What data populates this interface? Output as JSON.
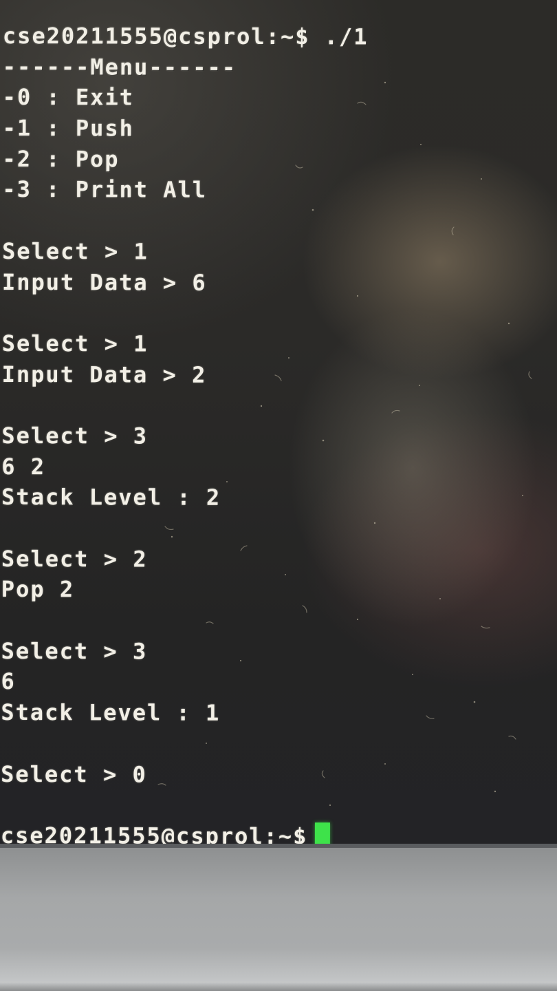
{
  "terminal": {
    "lines": [
      "cse20211555@csprol:~$ ./1",
      "------Menu------",
      "-0 : Exit",
      "-1 : Push",
      "-2 : Pop",
      "-3 : Print All",
      "",
      "Select > 1",
      "Input Data > 6",
      "",
      "Select > 1",
      "Input Data > 2",
      "",
      "Select > 3",
      "6 2",
      "Stack Level : 2",
      "",
      "Select > 2",
      "Pop 2",
      "",
      "Select > 3",
      "6",
      "Stack Level : 1",
      "",
      "Select > 0",
      ""
    ],
    "prompt": "cse20211555@csprol:~$",
    "cursor_color": "#3ee24a",
    "text_color": "#f2efe6",
    "background_color": "#2b2a28"
  }
}
